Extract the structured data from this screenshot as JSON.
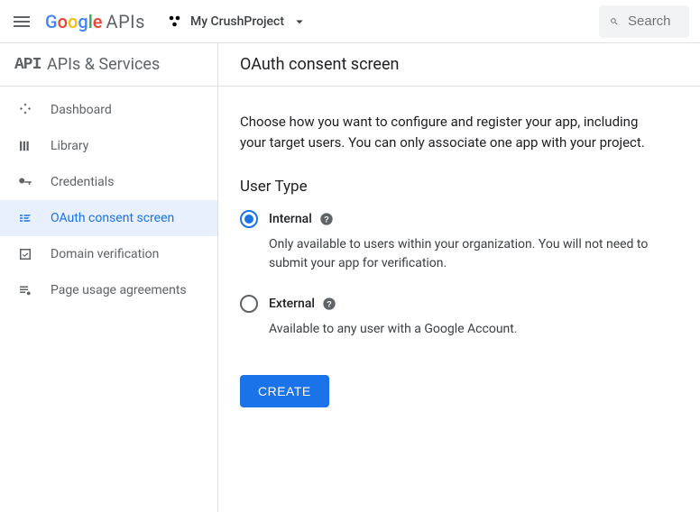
{
  "header": {
    "logo_suffix": "APIs",
    "project_name": "My CrushProject",
    "search_placeholder": "Search"
  },
  "sidebar": {
    "title": "APIs & Services",
    "items": [
      {
        "label": "Dashboard"
      },
      {
        "label": "Library"
      },
      {
        "label": "Credentials"
      },
      {
        "label": "OAuth consent screen"
      },
      {
        "label": "Domain verification"
      },
      {
        "label": "Page usage agreements"
      }
    ]
  },
  "main": {
    "title": "OAuth consent screen",
    "description": "Choose how you want to configure and register your app, including your target users. You can only associate one app with your project.",
    "section_title": "User Type",
    "options": [
      {
        "label": "Internal",
        "desc": "Only available to users within your organization. You will not need to submit your app for verification.",
        "selected": true
      },
      {
        "label": "External",
        "desc": "Available to any user with a Google Account.",
        "selected": false
      }
    ],
    "create_button": "CREATE"
  }
}
